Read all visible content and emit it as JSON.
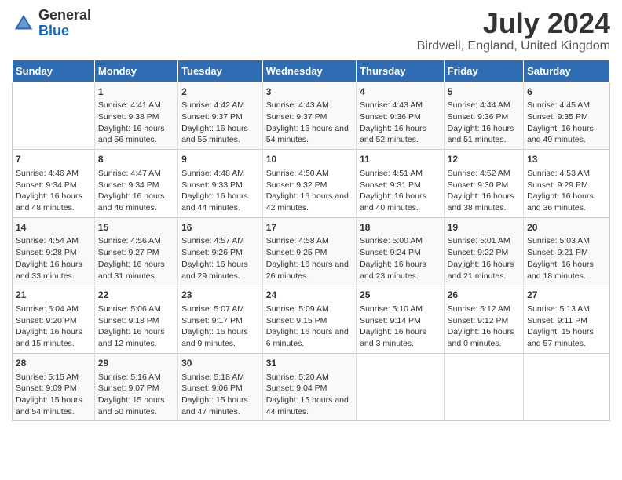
{
  "header": {
    "logo_line1": "General",
    "logo_line2": "Blue",
    "month_title": "July 2024",
    "location": "Birdwell, England, United Kingdom"
  },
  "days_of_week": [
    "Sunday",
    "Monday",
    "Tuesday",
    "Wednesday",
    "Thursday",
    "Friday",
    "Saturday"
  ],
  "weeks": [
    [
      {
        "num": "",
        "sunrise": "",
        "sunset": "",
        "daylight": ""
      },
      {
        "num": "1",
        "sunrise": "Sunrise: 4:41 AM",
        "sunset": "Sunset: 9:38 PM",
        "daylight": "Daylight: 16 hours and 56 minutes."
      },
      {
        "num": "2",
        "sunrise": "Sunrise: 4:42 AM",
        "sunset": "Sunset: 9:37 PM",
        "daylight": "Daylight: 16 hours and 55 minutes."
      },
      {
        "num": "3",
        "sunrise": "Sunrise: 4:43 AM",
        "sunset": "Sunset: 9:37 PM",
        "daylight": "Daylight: 16 hours and 54 minutes."
      },
      {
        "num": "4",
        "sunrise": "Sunrise: 4:43 AM",
        "sunset": "Sunset: 9:36 PM",
        "daylight": "Daylight: 16 hours and 52 minutes."
      },
      {
        "num": "5",
        "sunrise": "Sunrise: 4:44 AM",
        "sunset": "Sunset: 9:36 PM",
        "daylight": "Daylight: 16 hours and 51 minutes."
      },
      {
        "num": "6",
        "sunrise": "Sunrise: 4:45 AM",
        "sunset": "Sunset: 9:35 PM",
        "daylight": "Daylight: 16 hours and 49 minutes."
      }
    ],
    [
      {
        "num": "7",
        "sunrise": "Sunrise: 4:46 AM",
        "sunset": "Sunset: 9:34 PM",
        "daylight": "Daylight: 16 hours and 48 minutes."
      },
      {
        "num": "8",
        "sunrise": "Sunrise: 4:47 AM",
        "sunset": "Sunset: 9:34 PM",
        "daylight": "Daylight: 16 hours and 46 minutes."
      },
      {
        "num": "9",
        "sunrise": "Sunrise: 4:48 AM",
        "sunset": "Sunset: 9:33 PM",
        "daylight": "Daylight: 16 hours and 44 minutes."
      },
      {
        "num": "10",
        "sunrise": "Sunrise: 4:50 AM",
        "sunset": "Sunset: 9:32 PM",
        "daylight": "Daylight: 16 hours and 42 minutes."
      },
      {
        "num": "11",
        "sunrise": "Sunrise: 4:51 AM",
        "sunset": "Sunset: 9:31 PM",
        "daylight": "Daylight: 16 hours and 40 minutes."
      },
      {
        "num": "12",
        "sunrise": "Sunrise: 4:52 AM",
        "sunset": "Sunset: 9:30 PM",
        "daylight": "Daylight: 16 hours and 38 minutes."
      },
      {
        "num": "13",
        "sunrise": "Sunrise: 4:53 AM",
        "sunset": "Sunset: 9:29 PM",
        "daylight": "Daylight: 16 hours and 36 minutes."
      }
    ],
    [
      {
        "num": "14",
        "sunrise": "Sunrise: 4:54 AM",
        "sunset": "Sunset: 9:28 PM",
        "daylight": "Daylight: 16 hours and 33 minutes."
      },
      {
        "num": "15",
        "sunrise": "Sunrise: 4:56 AM",
        "sunset": "Sunset: 9:27 PM",
        "daylight": "Daylight: 16 hours and 31 minutes."
      },
      {
        "num": "16",
        "sunrise": "Sunrise: 4:57 AM",
        "sunset": "Sunset: 9:26 PM",
        "daylight": "Daylight: 16 hours and 29 minutes."
      },
      {
        "num": "17",
        "sunrise": "Sunrise: 4:58 AM",
        "sunset": "Sunset: 9:25 PM",
        "daylight": "Daylight: 16 hours and 26 minutes."
      },
      {
        "num": "18",
        "sunrise": "Sunrise: 5:00 AM",
        "sunset": "Sunset: 9:24 PM",
        "daylight": "Daylight: 16 hours and 23 minutes."
      },
      {
        "num": "19",
        "sunrise": "Sunrise: 5:01 AM",
        "sunset": "Sunset: 9:22 PM",
        "daylight": "Daylight: 16 hours and 21 minutes."
      },
      {
        "num": "20",
        "sunrise": "Sunrise: 5:03 AM",
        "sunset": "Sunset: 9:21 PM",
        "daylight": "Daylight: 16 hours and 18 minutes."
      }
    ],
    [
      {
        "num": "21",
        "sunrise": "Sunrise: 5:04 AM",
        "sunset": "Sunset: 9:20 PM",
        "daylight": "Daylight: 16 hours and 15 minutes."
      },
      {
        "num": "22",
        "sunrise": "Sunrise: 5:06 AM",
        "sunset": "Sunset: 9:18 PM",
        "daylight": "Daylight: 16 hours and 12 minutes."
      },
      {
        "num": "23",
        "sunrise": "Sunrise: 5:07 AM",
        "sunset": "Sunset: 9:17 PM",
        "daylight": "Daylight: 16 hours and 9 minutes."
      },
      {
        "num": "24",
        "sunrise": "Sunrise: 5:09 AM",
        "sunset": "Sunset: 9:15 PM",
        "daylight": "Daylight: 16 hours and 6 minutes."
      },
      {
        "num": "25",
        "sunrise": "Sunrise: 5:10 AM",
        "sunset": "Sunset: 9:14 PM",
        "daylight": "Daylight: 16 hours and 3 minutes."
      },
      {
        "num": "26",
        "sunrise": "Sunrise: 5:12 AM",
        "sunset": "Sunset: 9:12 PM",
        "daylight": "Daylight: 16 hours and 0 minutes."
      },
      {
        "num": "27",
        "sunrise": "Sunrise: 5:13 AM",
        "sunset": "Sunset: 9:11 PM",
        "daylight": "Daylight: 15 hours and 57 minutes."
      }
    ],
    [
      {
        "num": "28",
        "sunrise": "Sunrise: 5:15 AM",
        "sunset": "Sunset: 9:09 PM",
        "daylight": "Daylight: 15 hours and 54 minutes."
      },
      {
        "num": "29",
        "sunrise": "Sunrise: 5:16 AM",
        "sunset": "Sunset: 9:07 PM",
        "daylight": "Daylight: 15 hours and 50 minutes."
      },
      {
        "num": "30",
        "sunrise": "Sunrise: 5:18 AM",
        "sunset": "Sunset: 9:06 PM",
        "daylight": "Daylight: 15 hours and 47 minutes."
      },
      {
        "num": "31",
        "sunrise": "Sunrise: 5:20 AM",
        "sunset": "Sunset: 9:04 PM",
        "daylight": "Daylight: 15 hours and 44 minutes."
      },
      {
        "num": "",
        "sunrise": "",
        "sunset": "",
        "daylight": ""
      },
      {
        "num": "",
        "sunrise": "",
        "sunset": "",
        "daylight": ""
      },
      {
        "num": "",
        "sunrise": "",
        "sunset": "",
        "daylight": ""
      }
    ]
  ]
}
